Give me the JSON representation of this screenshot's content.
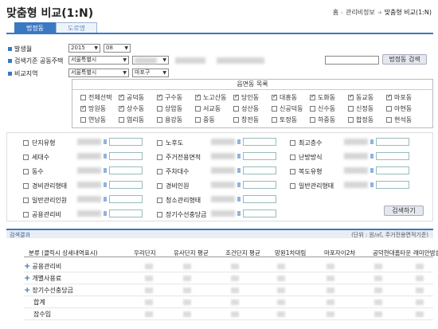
{
  "page": {
    "title": "맞춤형 비교(1:N)"
  },
  "breadcrumb": {
    "home": "홈",
    "section": "관리비정보",
    "current": "맞춤형 비교(1:N)"
  },
  "tabs": [
    {
      "label": "법정동",
      "active": true
    },
    {
      "label": "도로명",
      "active": false
    }
  ],
  "form": {
    "date_label": "발생월",
    "year": "2015",
    "month": "08",
    "complex_label": "검색기준 공동주택",
    "complex_city": "서울특별시",
    "complex_gu": "용산구",
    "search_button": "법정동 검색",
    "compare_label": "비교지역",
    "compare_city": "서울특별시",
    "compare_gu": "마포구"
  },
  "dong_section": {
    "header": "읍면동 목록",
    "items": [
      {
        "label": "전체선택",
        "checked": false
      },
      {
        "label": "공덕동",
        "checked": true
      },
      {
        "label": "구수동",
        "checked": true
      },
      {
        "label": "노고산동",
        "checked": true
      },
      {
        "label": "당인동",
        "checked": true
      },
      {
        "label": "대흥동",
        "checked": true
      },
      {
        "label": "도화동",
        "checked": true
      },
      {
        "label": "동교동",
        "checked": true
      },
      {
        "label": "마포동",
        "checked": true
      },
      {
        "label": "망원동",
        "checked": true
      },
      {
        "label": "상수동",
        "checked": true
      },
      {
        "label": "상암동",
        "checked": false
      },
      {
        "label": "서교동",
        "checked": false
      },
      {
        "label": "성산동",
        "checked": false
      },
      {
        "label": "신공덕동",
        "checked": false
      },
      {
        "label": "신수동",
        "checked": false
      },
      {
        "label": "신정동",
        "checked": false
      },
      {
        "label": "아현동",
        "checked": false
      },
      {
        "label": "연남동",
        "checked": false
      },
      {
        "label": "염리동",
        "checked": false
      },
      {
        "label": "용강동",
        "checked": false
      },
      {
        "label": "중동",
        "checked": false
      },
      {
        "label": "창전동",
        "checked": false
      },
      {
        "label": "토정동",
        "checked": false
      },
      {
        "label": "하중동",
        "checked": false
      },
      {
        "label": "합정동",
        "checked": false
      },
      {
        "label": "현석동",
        "checked": false
      }
    ]
  },
  "filters": {
    "col1": [
      "단지유형",
      "세대수",
      "동수",
      "경비관리형태",
      "일반관리인원",
      "공용관리비"
    ],
    "col2": [
      "노후도",
      "주거전용면적",
      "주차대수",
      "경비인원",
      "청소관리형태",
      "장기수선충당금"
    ],
    "col3": [
      "최고층수",
      "난방방식",
      "복도유형",
      "일반관리형태"
    ],
    "detail_search_button": "검색하기"
  },
  "results": {
    "title": "검색결과",
    "unit": "(단위 : 원/㎡, 주거전용면적기준)",
    "columns": [
      "분류 (클릭시 상세내역표시)",
      "우리단지",
      "유사단지 평균",
      "조건단지 평균",
      "망원1차대림",
      "마포자이2차",
      "공덕현대홈타운",
      "래미안밤섬리"
    ],
    "rows": [
      {
        "label": "공용관리비",
        "expandable": true
      },
      {
        "label": "개별사용료",
        "expandable": true
      },
      {
        "label": "장기수선충당금",
        "expandable": true
      },
      {
        "label": "합계",
        "expandable": false
      },
      {
        "label": "잡수입",
        "expandable": false
      }
    ]
  }
}
